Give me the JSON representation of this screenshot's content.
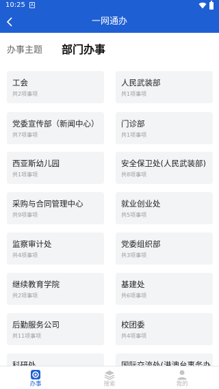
{
  "status_bar": {
    "time": "10:25",
    "notification_glyph": "A"
  },
  "nav": {
    "title": "一网通办"
  },
  "tabs": {
    "theme_label": "办事主题",
    "department_label": "部门办事"
  },
  "departments": [
    {
      "name": "工会",
      "count": "共2项事项"
    },
    {
      "name": "人民武装部",
      "count": "共1项事项"
    },
    {
      "name": "党委宣传部（新闻中心）",
      "count": "共7项事项"
    },
    {
      "name": "门诊部",
      "count": "共1项事项"
    },
    {
      "name": "西亚斯幼儿园",
      "count": "共1项事项"
    },
    {
      "name": "安全保卫处(人民武装部)",
      "count": "共8项事项"
    },
    {
      "name": "采购与合同管理中心",
      "count": "共9项事项"
    },
    {
      "name": "就业创业处",
      "count": "共5项事项"
    },
    {
      "name": "监察审计处",
      "count": "共4项事项"
    },
    {
      "name": "党委组织部",
      "count": "共3项事项"
    },
    {
      "name": "继续教育学院",
      "count": "共2项事项"
    },
    {
      "name": "基建处",
      "count": "共6项事项"
    },
    {
      "name": "后勤服务公司",
      "count": "共11项事项"
    },
    {
      "name": "校团委",
      "count": "共4项事项"
    },
    {
      "name": "科研处",
      "count": ""
    },
    {
      "name": "国际交流处(港澳台事务办",
      "count": ""
    }
  ],
  "tabbar": {
    "items": [
      {
        "label": "办事",
        "icon": "target-icon",
        "active": true
      },
      {
        "label": "搜索",
        "icon": "layers-icon",
        "active": false
      },
      {
        "label": "我的",
        "icon": "user-icon",
        "active": false
      }
    ]
  },
  "colors": {
    "primary": "#1f5fd4",
    "card_bg": "#f3f4f6",
    "inactive": "#b8b8b8"
  }
}
